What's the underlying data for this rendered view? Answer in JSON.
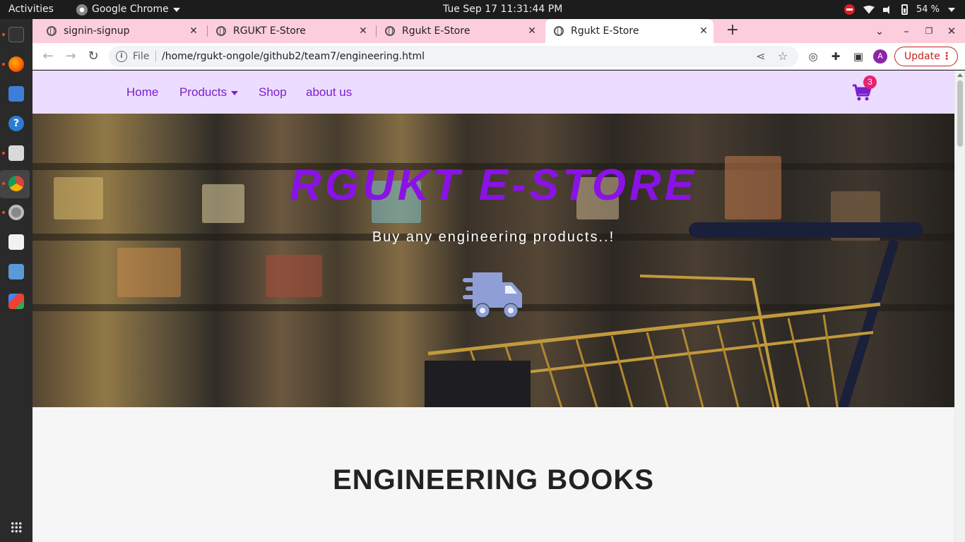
{
  "system": {
    "activities": "Activities",
    "app_name": "Google Chrome",
    "clock": "Tue Sep 17  11:31:44 PM",
    "battery": "54 %"
  },
  "browser": {
    "tabs": [
      {
        "title": "signin-signup",
        "active": false
      },
      {
        "title": "RGUKT E-Store",
        "active": false
      },
      {
        "title": "Rgukt E-Store",
        "active": false
      },
      {
        "title": "Rgukt E-Store",
        "active": true
      }
    ],
    "address": {
      "scheme_label": "File",
      "url": "/home/rgukt-ongole/github2/team7/engineering.html"
    },
    "profile_initial": "A",
    "update_label": "Update"
  },
  "site": {
    "nav": {
      "home": "Home",
      "products": "Products",
      "shop": "Shop",
      "about": "about us"
    },
    "cart_count": "3",
    "hero": {
      "title": "RGUKT E-STORE",
      "subtitle": "Buy any engineering products..!"
    },
    "section_title": "ENGINEERING BOOKS"
  },
  "colors": {
    "accent": "#7a1fd0",
    "nav_bg": "#ecdcff",
    "tab_strip": "#fccddc",
    "badge": "#e8226f"
  },
  "icons": [
    "terminal-icon",
    "firefox-icon",
    "text-editor-icon",
    "help-icon",
    "files-icon",
    "chrome-icon",
    "settings-icon",
    "software-icon",
    "package-icon",
    "gmail-icon",
    "apps-grid-icon",
    "truck-icon",
    "cart-icon"
  ]
}
